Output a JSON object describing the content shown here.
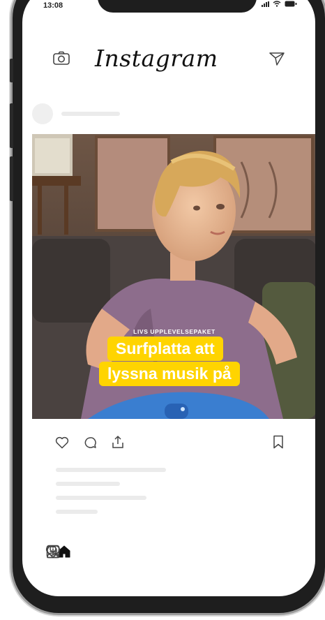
{
  "status_bar": {
    "time": "13:08"
  },
  "header": {
    "logo": "Instagram"
  },
  "post": {
    "overlay_kicker": "LIVS UPPLEVELSEPAKET",
    "overlay_line1": "Surfplatta att",
    "overlay_line2": "lyssna musik på"
  },
  "icons": {
    "camera": "camera-icon",
    "direct": "paper-plane-icon",
    "like": "heart-icon",
    "comment": "comment-icon",
    "share": "share-icon",
    "save": "bookmark-icon",
    "home": "home-icon",
    "search": "search-icon",
    "add": "add-post-icon",
    "activity": "heart-icon",
    "profile": "profile-icon"
  },
  "colors": {
    "caption_yellow": "#ffd400",
    "text_dark": "#111111"
  }
}
